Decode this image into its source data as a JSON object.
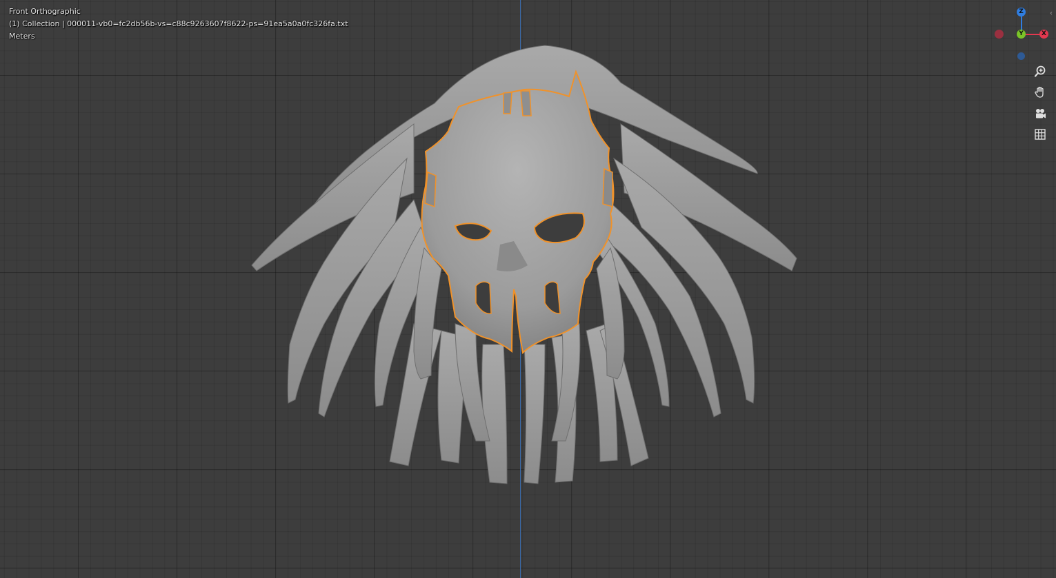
{
  "viewport": {
    "view_name": "Front Orthographic",
    "collection_info": "(1) Collection | 000011-vb0=fc2db56b-vs=c88c9263607f8622-ps=91ea5a0a0fc326fa.txt",
    "units": "Meters"
  },
  "gizmo": {
    "z_label": "Z",
    "y_label": "Y",
    "x_label": "X",
    "colors": {
      "z": "#2f7de0",
      "y": "#7ac428",
      "x": "#e3384f",
      "neg_x": "#9a3040",
      "neg_z": "#2e5a95"
    }
  },
  "nav_buttons": [
    {
      "name": "zoom-icon"
    },
    {
      "name": "hand-pan-icon"
    },
    {
      "name": "camera-view-icon"
    },
    {
      "name": "grid-toggle-icon"
    }
  ],
  "model": {
    "selection_outline_color": "#f0922a",
    "mesh_color": "#9a9a9a"
  }
}
